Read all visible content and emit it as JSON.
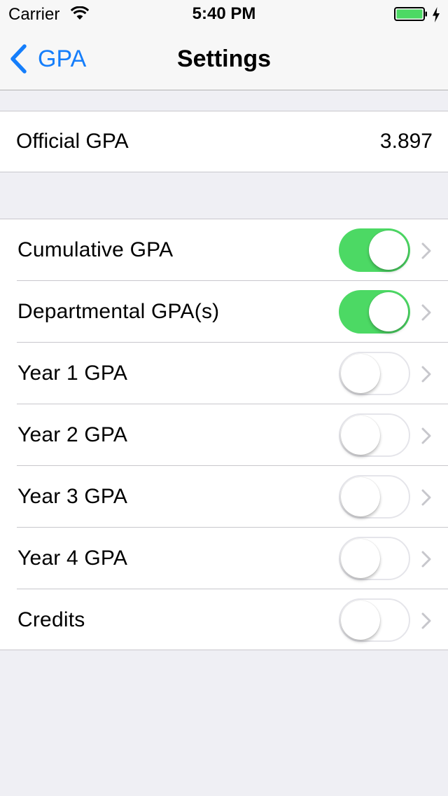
{
  "status_bar": {
    "carrier": "Carrier",
    "time": "5:40 PM",
    "battery_color": "#4CD964",
    "icons": [
      "wifi-icon",
      "battery-icon",
      "charging-icon"
    ]
  },
  "nav": {
    "back_label": "GPA",
    "title": "Settings",
    "accent_color": "#157EFB"
  },
  "official": {
    "label": "Official GPA",
    "value": "3.897"
  },
  "rows": [
    {
      "label": "Cumulative GPA",
      "on": true
    },
    {
      "label": "Departmental GPA(s)",
      "on": true
    },
    {
      "label": "Year 1 GPA",
      "on": false
    },
    {
      "label": "Year 2 GPA",
      "on": false
    },
    {
      "label": "Year 3 GPA",
      "on": false
    },
    {
      "label": "Year 4 GPA",
      "on": false
    },
    {
      "label": "Credits",
      "on": false
    }
  ],
  "switch_on_color": "#4CD964"
}
